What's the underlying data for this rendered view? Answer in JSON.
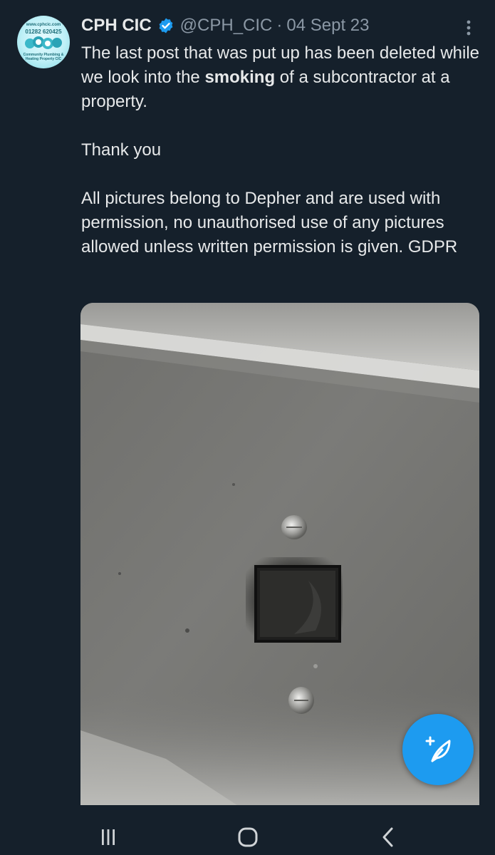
{
  "tweet": {
    "author_name": "CPH CIC",
    "handle": "@CPH_CIC",
    "separator": "·",
    "date": "04 Sept 23",
    "text": {
      "line1_before": "The last post that was put up has been deleted while we look into the ",
      "line1_bold": "smoking",
      "line1_after": " of a subcontractor at a property.",
      "para2": "Thank you",
      "para3": "All pictures belong to Depher and are used with permission, no unauthorised use of any pictures allowed unless written permission is given. GDPR"
    },
    "avatar": {
      "line1": "www.cphcic.com",
      "line2": "01282 620425",
      "line3": "Community Plumbing & Heating Property CIC"
    }
  },
  "icons": {
    "verified": "verified-badge-icon",
    "more": "more-options-icon",
    "compose": "compose-post-icon",
    "nav_recents": "recent-apps-icon",
    "nav_home": "home-icon",
    "nav_back": "back-icon"
  },
  "colors": {
    "background": "#15202b",
    "accent": "#1d9bf0",
    "text_primary": "#e7e9ea",
    "text_secondary": "#8b98a5"
  }
}
